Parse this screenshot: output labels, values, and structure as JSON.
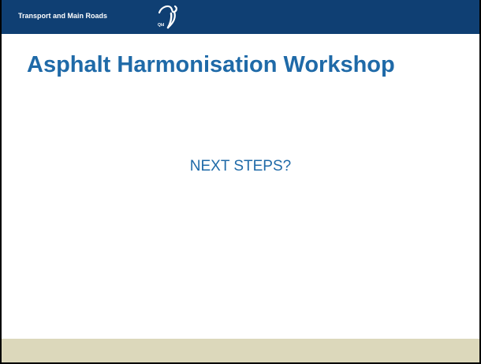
{
  "header": {
    "org_name": "Transport and Main Roads",
    "logo_icon": "queensland-government-logo-icon",
    "logo_caption": "Qld"
  },
  "slide": {
    "title": "Asphalt Harmonisation Workshop",
    "body_text": "NEXT STEPS?"
  },
  "colors": {
    "header_bar": "#0f3f73",
    "title_text": "#1f6aa8",
    "footer_bar": "#dcd8bb"
  }
}
